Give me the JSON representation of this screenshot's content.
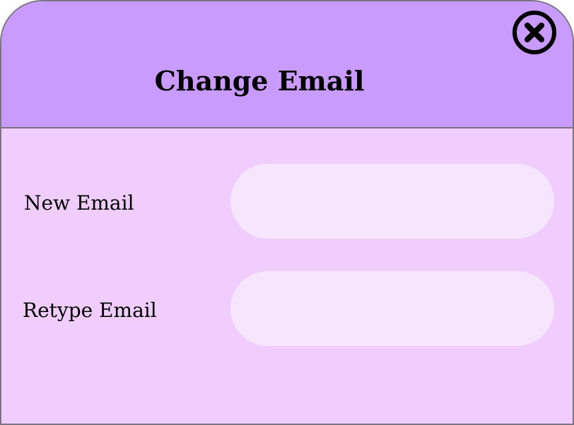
{
  "dialog": {
    "title": "Change Email",
    "close_icon": "close-circle-icon",
    "fields": {
      "new_email": {
        "label": "New Email",
        "value": "",
        "placeholder": ""
      },
      "retype_email": {
        "label": "Retype Email",
        "value": "",
        "placeholder": ""
      }
    }
  },
  "colors": {
    "header_background": "#c89bfd",
    "body_background": "#f0cdfd",
    "input_background": "#f6e6fd",
    "border": "#7a7483"
  }
}
